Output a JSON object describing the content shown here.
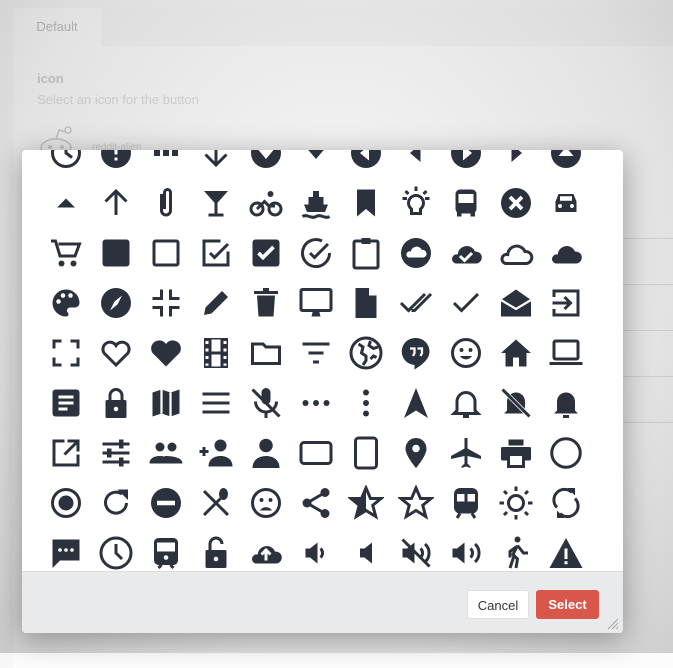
{
  "background": {
    "tab_label": "Default",
    "field_label": "icon",
    "field_description": "Select an icon for the button",
    "current_icon_text": "reddit-alien"
  },
  "colors": {
    "icon": "#2b323e",
    "select_button": "#d9574a",
    "footer": "#e9eaec"
  },
  "modal": {
    "icons": [
      "clock-icon",
      "alert-circle-icon",
      "apps-icon",
      "arrow-down-icon",
      "arrow-dropdown-circle-icon",
      "arrow-dropdown-icon",
      "arrow-dropleft-circle-icon",
      "arrow-dropleft-icon",
      "arrow-dropright-circle-icon",
      "arrow-dropright-icon",
      "arrow-dropup-circle-icon",
      "arrow-dropup-icon",
      "arrow-up-icon",
      "attach-icon",
      "cocktail-icon",
      "bicycle-icon",
      "boat-icon",
      "bookmark-icon",
      "bulb-icon",
      "bus-icon",
      "close-circle-icon",
      "car-icon",
      "cart-icon",
      "square-icon",
      "square-outline-icon",
      "checkbox-outline-icon",
      "checkbox-icon",
      "checkmark-circle-outline-icon",
      "clipboard-icon",
      "cloud-circle-icon",
      "cloud-done-icon",
      "cloud-outline-icon",
      "cloud-icon",
      "palette-icon",
      "compass-icon",
      "contract-icon",
      "pencil-icon",
      "trash-icon",
      "desktop-icon",
      "document-icon",
      "done-all-icon",
      "checkmark-icon",
      "mail-open-icon",
      "exit-icon",
      "expand-icon",
      "heart-outline-icon",
      "heart-icon",
      "film-icon",
      "folder-outline-icon",
      "funnel-icon",
      "globe-icon",
      "hangout-icon",
      "happy-icon",
      "home-icon",
      "laptop-icon",
      "list-box-icon",
      "lock-icon",
      "map-icon",
      "menu-icon",
      "mic-off-icon",
      "more-horizontal-icon",
      "more-vertical-icon",
      "navigate-icon",
      "notifications-outline-icon",
      "notifications-off-icon",
      "notifications-icon",
      "open-icon",
      "options-icon",
      "people-icon",
      "person-add-icon",
      "person-icon",
      "tablet-landscape-icon",
      "tablet-portrait-icon",
      "pin-icon",
      "plane-icon",
      "print-icon",
      "radio-button-off-icon",
      "radio-button-on-icon",
      "refresh-icon",
      "remove-circle-icon",
      "restaurant-icon",
      "sad-icon",
      "share-icon",
      "star-half-icon",
      "star-outline-icon",
      "subway-icon",
      "sunny-icon",
      "sync-icon",
      "text-icon",
      "time-icon",
      "train-icon",
      "unlock-icon",
      "cloud-upload-icon",
      "volume-down-icon",
      "volume-mute-icon",
      "volume-off-icon",
      "volume-up-icon",
      "walk-icon",
      "warning-icon"
    ],
    "cancel_label": "Cancel",
    "select_label": "Select"
  }
}
